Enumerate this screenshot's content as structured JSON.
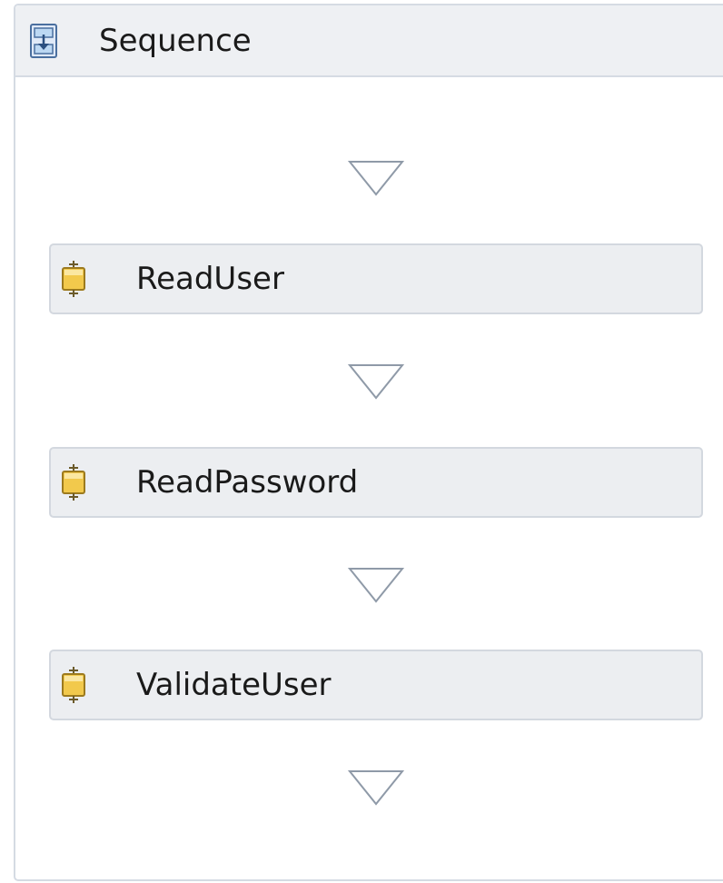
{
  "sequence": {
    "title": "Sequence",
    "icon": "sequence-icon"
  },
  "activities": [
    {
      "label": "ReadUser",
      "icon": "activity-icon"
    },
    {
      "label": "ReadPassword",
      "icon": "activity-icon"
    },
    {
      "label": "ValidateUser",
      "icon": "activity-icon"
    }
  ],
  "colors": {
    "border": "#d5dbe3",
    "header_bg": "#eef0f3",
    "activity_bg": "#eceef1",
    "arrow": "#8f9aa8",
    "icon_gold": "#f2c94c"
  }
}
